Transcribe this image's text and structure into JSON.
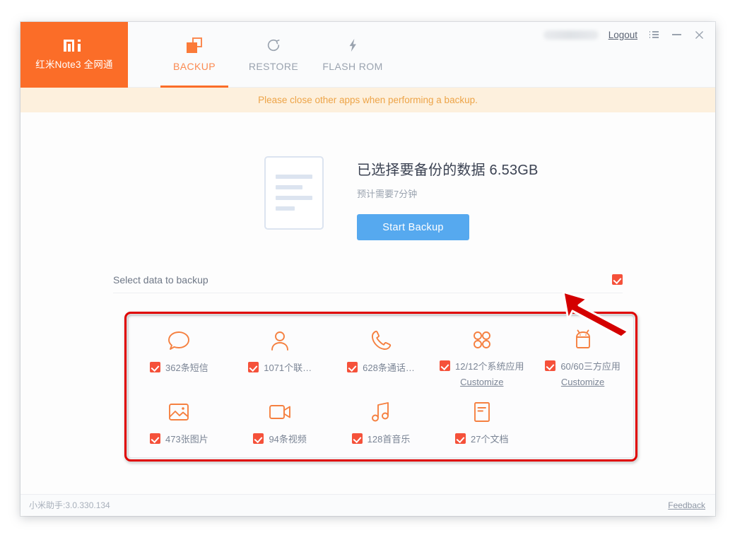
{
  "window": {
    "brand": {
      "logo": "mi-logo",
      "device_name": "红米Note3 全网通"
    },
    "tabs": [
      {
        "label": "BACKUP",
        "icon": "backup-icon",
        "active": true
      },
      {
        "label": "RESTORE",
        "icon": "restore-icon",
        "active": false
      },
      {
        "label": "FLASH ROM",
        "icon": "flash-icon",
        "active": false
      }
    ],
    "titlebar": {
      "username_masked": "",
      "logout_label": "Logout",
      "menu_icon": "hamburger-menu-icon",
      "minimize_icon": "minimize-icon",
      "close_icon": "close-icon"
    }
  },
  "notice": {
    "text": "Please close other apps when performing a backup."
  },
  "summary": {
    "illustration": "document-illustration",
    "title": "已选择要备份的数据 6.53GB",
    "size_value": "6.53GB",
    "subtitle": "预计需要7分钟",
    "start_button": "Start Backup"
  },
  "select_section": {
    "label": "Select data to backup",
    "select_all_checked": true
  },
  "data_items": [
    {
      "icon": "sms-icon",
      "label": "362条短信",
      "checked": true,
      "customize": null
    },
    {
      "icon": "contact-icon",
      "label": "1071个联…",
      "checked": true,
      "customize": null
    },
    {
      "icon": "call-log-icon",
      "label": "628条通话…",
      "checked": true,
      "customize": null
    },
    {
      "icon": "system-app-icon",
      "label": "12/12个系统应用",
      "checked": true,
      "customize": "Customize"
    },
    {
      "icon": "android-app-icon",
      "label": "60/60三方应用",
      "checked": true,
      "customize": "Customize"
    },
    {
      "icon": "photo-icon",
      "label": "473张图片",
      "checked": true,
      "customize": null
    },
    {
      "icon": "video-icon",
      "label": "94条视频",
      "checked": true,
      "customize": null
    },
    {
      "icon": "music-icon",
      "label": "128首音乐",
      "checked": true,
      "customize": null
    },
    {
      "icon": "document-icon",
      "label": "27个文档",
      "checked": true,
      "customize": null
    }
  ],
  "footer": {
    "version": "小米助手:3.0.330.134",
    "feedback_label": "Feedback"
  },
  "annotations": {
    "highlight_box": "red-rounded-rectangle-around-data-card",
    "arrow": "red-arrow-pointing-to-backup-size"
  },
  "colors": {
    "brand_orange": "#fb6d28",
    "icon_orange": "#f58040",
    "checkbox_red": "#f5513a",
    "button_blue": "#56a9ef",
    "notice_bg": "#fdf0dd",
    "notice_text": "#eda448",
    "annotation_red": "#e00000"
  }
}
